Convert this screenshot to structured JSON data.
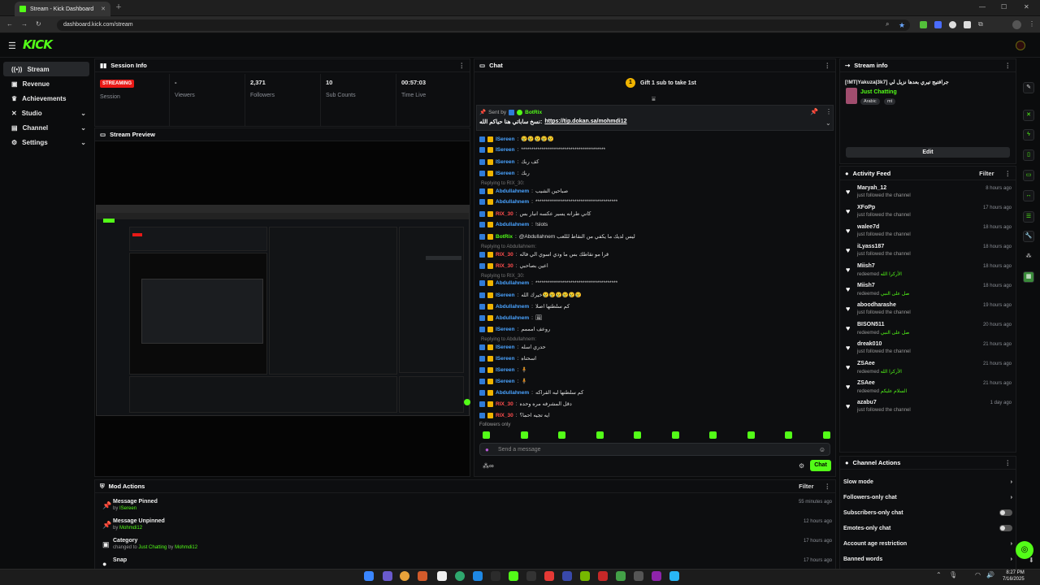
{
  "browser": {
    "tab_title": "Stream - Kick Dashboard",
    "url": "dashboard.kick.com/stream"
  },
  "app": {
    "logo": "KICK",
    "brand_color": "#53fc18"
  },
  "sidebar": {
    "items": [
      {
        "label": "Stream",
        "icon": "broadcast-icon"
      },
      {
        "label": "Revenue",
        "icon": "dollar-icon"
      },
      {
        "label": "Achievements",
        "icon": "trophy-icon"
      },
      {
        "label": "Studio",
        "icon": "studio-icon"
      },
      {
        "label": "Channel",
        "icon": "channel-icon"
      },
      {
        "label": "Settings",
        "icon": "gear-icon"
      }
    ]
  },
  "session_info": {
    "title": "Session Info",
    "status_badge": "STREAMING",
    "status_label": "Session",
    "stats": [
      {
        "value": "-",
        "label": "Viewers"
      },
      {
        "value": "2,371",
        "label": "Followers"
      },
      {
        "value": "10",
        "label": "Sub Counts"
      },
      {
        "value": "00:57:03",
        "label": "Time Live"
      }
    ]
  },
  "stream_preview": {
    "title": "Stream Preview"
  },
  "chat": {
    "title": "Chat",
    "gift_banner": "Gift 1 sub to take 1st",
    "gift_count": "1",
    "pinned_sent_by": "Sent by",
    "pinned_user": "BotRix",
    "pinned_text": "نسخ ساباتي هنا حياكم الله:",
    "pinned_link": "https://tip.dokan.sa/mohmdi12",
    "messages": [
      {
        "user": "ISereen",
        "color": "#4aa3ff",
        "text": "😢😢😢😢😢"
      },
      {
        "user": "ISereen",
        "color": "#4aa3ff",
        "text": "*****************************************"
      },
      {
        "user": "ISereen",
        "color": "#4aa3ff",
        "text": "كف ربك"
      },
      {
        "user": "ISereen",
        "color": "#4aa3ff",
        "text": "ربك"
      },
      {
        "user": "Abdullahnem",
        "color": "#4aa3ff",
        "text": "صباحين الشيب",
        "reply": "Replying to RIX_30:"
      },
      {
        "user": "Abdullahnem",
        "color": "#4aa3ff",
        "text": "****************************************"
      },
      {
        "user": "RIX_30",
        "color": "#ff4d4d",
        "text": "كاني طرانه يسير عكسه انبار بس"
      },
      {
        "user": "Abdullahnem",
        "color": "#4aa3ff",
        "text": "!slots"
      },
      {
        "user": "BotRix",
        "color": "#53fc18",
        "text": "@Abdullahnem ليس لديك ما يكفي من النقاط لللعب"
      },
      {
        "user": "RIX_30",
        "color": "#ff4d4d",
        "text": "قرا مو نقاطك بس ما ودي اسوي الي فاله",
        "reply": "Replying to Abdullahnem:"
      },
      {
        "user": "RIX_30",
        "color": "#ff4d4d",
        "text": "اعين بصاحبي"
      },
      {
        "user": "Abdullahnem",
        "color": "#4aa3ff",
        "text": "****************************************",
        "reply": "Replying to RIX_30:"
      },
      {
        "user": "ISereen",
        "color": "#4aa3ff",
        "text": "خيرك الله😢😢😢😢😢😢"
      },
      {
        "user": "Abdullahnem",
        "color": "#4aa3ff",
        "text": "كم سلطتها اصلا"
      },
      {
        "user": "Abdullahnem",
        "color": "#4aa3ff",
        "text": "🖼"
      },
      {
        "user": "ISereen",
        "color": "#4aa3ff",
        "text": "روعف امممم"
      },
      {
        "user": "ISereen",
        "color": "#4aa3ff",
        "text": "حدري اسله",
        "reply": "Replying to Abdullahnem:"
      },
      {
        "user": "ISereen",
        "color": "#4aa3ff",
        "text": "اسحتاه"
      },
      {
        "user": "ISereen",
        "color": "#4aa3ff",
        "text": "🧍"
      },
      {
        "user": "ISereen",
        "color": "#4aa3ff",
        "text": "🧍"
      },
      {
        "user": "Abdullahnem",
        "color": "#4aa3ff",
        "text": "كم سلطتها لبه القراكه"
      },
      {
        "user": "RIX_30",
        "color": "#ff4d4d",
        "text": "دقل المشرفه مره وحده"
      },
      {
        "user": "RIX_30",
        "color": "#ff4d4d",
        "text": "ايه تجيه احما؟"
      }
    ],
    "followers_only": "Followers only",
    "input_placeholder": "Send a message",
    "send_label": "Chat"
  },
  "stream_info": {
    "title": "Stream info",
    "stream_title": "[!MT|Yakuza|3k7] جرافتيج تيري بعدها نزيل لي",
    "category": "Just Chatting",
    "tags": [
      "Arabic",
      "mt"
    ],
    "edit_label": "Edit"
  },
  "activity_feed": {
    "title": "Activity Feed",
    "filter_label": "Filter",
    "items": [
      {
        "name": "Maryah_12",
        "desc": "just followed the channel",
        "time": "8 hours ago"
      },
      {
        "name": "XFoPp",
        "desc": "just followed the channel",
        "time": "17 hours ago"
      },
      {
        "name": "walee7d",
        "desc": "just followed the channel",
        "time": "18 hours ago"
      },
      {
        "name": "iLyass187",
        "desc": "just followed the channel",
        "time": "18 hours ago"
      },
      {
        "name": "Miish7",
        "desc": "redeemed",
        "reward": "الأركرا الله",
        "time": "18 hours ago"
      },
      {
        "name": "Miish7",
        "desc": "redeemed",
        "reward": "صل على النبي",
        "time": "18 hours ago"
      },
      {
        "name": "aboodharashe",
        "desc": "just followed the channel",
        "time": "19 hours ago"
      },
      {
        "name": "BISON511",
        "desc": "redeemed",
        "reward": "صل على النبي",
        "time": "20 hours ago"
      },
      {
        "name": "dreak010",
        "desc": "just followed the channel",
        "time": "21 hours ago"
      },
      {
        "name": "ZSAee",
        "desc": "redeemed",
        "reward": "الأركرا الله",
        "time": "21 hours ago"
      },
      {
        "name": "ZSAee",
        "desc": "redeemed",
        "reward": "السلام عليكم",
        "time": "21 hours ago"
      },
      {
        "name": "azabu7",
        "desc": "just followed the channel",
        "time": "1 day ago"
      }
    ]
  },
  "channel_actions": {
    "title": "Channel Actions",
    "items": [
      {
        "label": "Slow mode",
        "control": "chevron"
      },
      {
        "label": "Followers-only chat",
        "control": "chevron"
      },
      {
        "label": "Subscribers-only chat",
        "control": "toggle"
      },
      {
        "label": "Emotes-only chat",
        "control": "toggle"
      },
      {
        "label": "Account age restriction",
        "control": "chevron"
      },
      {
        "label": "Banned words",
        "control": "chevron"
      }
    ]
  },
  "mod_actions": {
    "title": "Mod Actions",
    "filter_label": "Filter",
    "items": [
      {
        "title": "Message Pinned",
        "by": "by",
        "user": "ISereen",
        "time": "55 minutes ago",
        "icon": "pin-icon"
      },
      {
        "title": "Message Unpinned",
        "by": "by",
        "user": "Mohmdi12",
        "time": "12 hours ago",
        "icon": "unpin-icon"
      },
      {
        "title": "Category",
        "by": "changed to",
        "user": "Just Chatting",
        "extra": "by",
        "extra_user": "Mohmdi12",
        "time": "17 hours ago",
        "icon": "category-icon"
      },
      {
        "title": "Snap",
        "by": "",
        "user": "",
        "time": "17 hours ago",
        "icon": "snap-icon"
      }
    ]
  },
  "taskbar": {
    "time": "8:27 PM",
    "date": "7/16/2025"
  }
}
